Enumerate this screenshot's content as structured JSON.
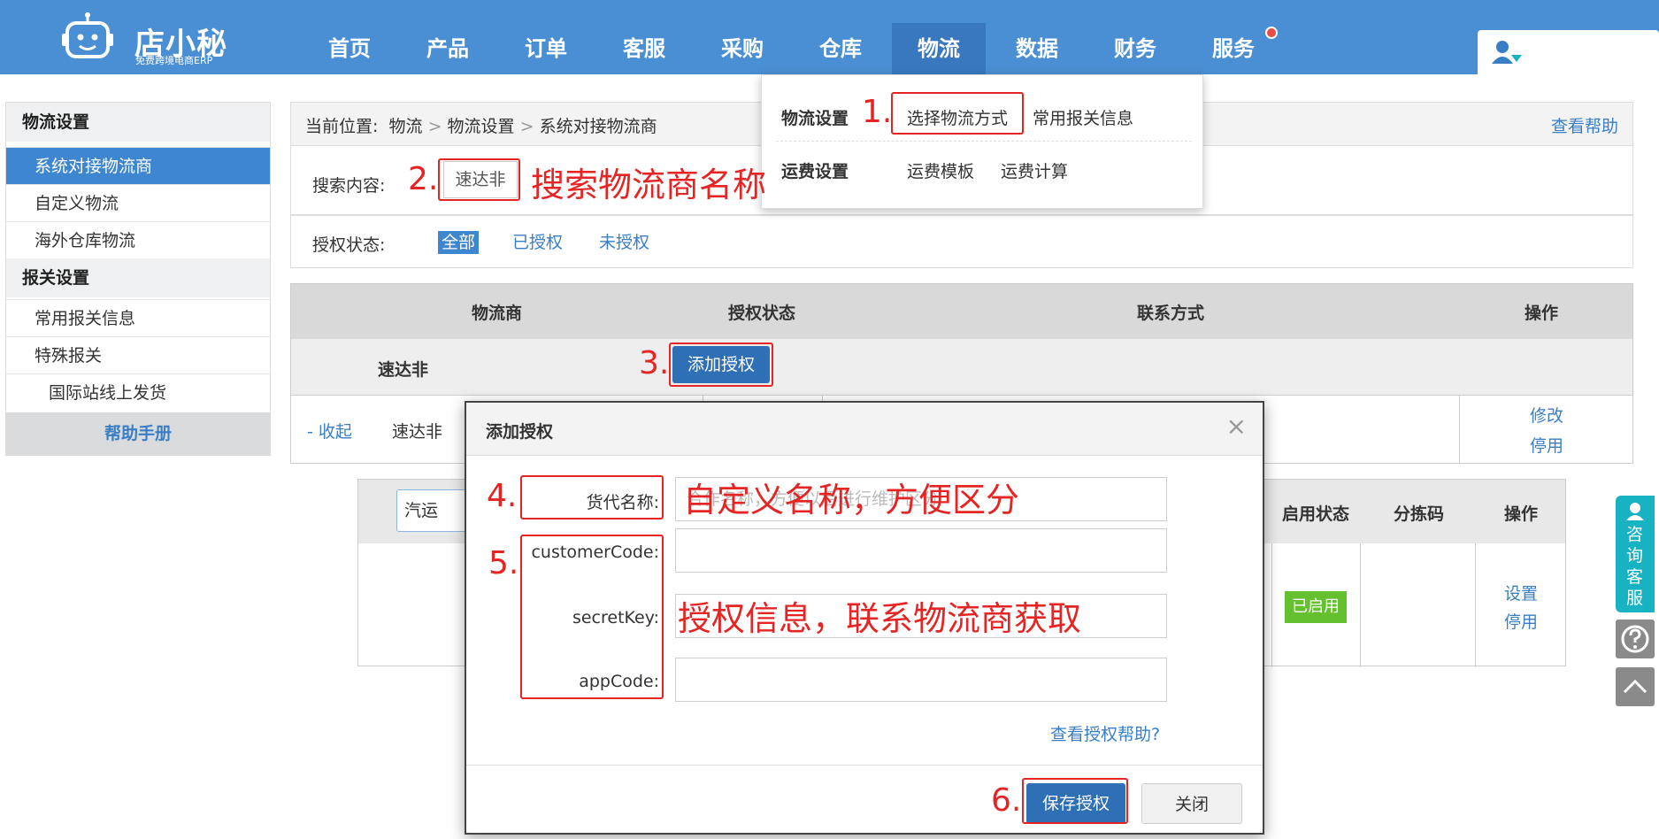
{
  "brand": {
    "name": "店小秘",
    "tagline": "免费跨境电商ERP"
  },
  "nav": {
    "items": [
      "首页",
      "产品",
      "订单",
      "客服",
      "采购",
      "仓库",
      "物流",
      "数据",
      "财务",
      "服务"
    ],
    "active": "物流",
    "accent": "#4a8fd3"
  },
  "sidebar": {
    "sections": [
      {
        "title": "物流设置",
        "items": [
          "系统对接物流商",
          "自定义物流",
          "海外仓库物流"
        ]
      },
      {
        "title": "报关设置",
        "items": [
          "常用报关信息",
          "特殊报关",
          "国际站线上发货"
        ]
      }
    ],
    "active_item": "系统对接物流商",
    "help": "帮助手册"
  },
  "breadcrumb": {
    "label": "当前位置:",
    "items": [
      "物流",
      "物流设置",
      "系统对接物流商"
    ],
    "help_link": "查看帮助"
  },
  "dropdown": {
    "row1": {
      "title": "物流设置",
      "links": [
        "选择物流方式",
        "常用报关信息"
      ]
    },
    "row2": {
      "title": "运费设置",
      "links": [
        "运费模板",
        "运费计算"
      ]
    }
  },
  "search": {
    "label": "搜索内容:",
    "value": "速达非"
  },
  "auth_filter": {
    "label": "授权状态:",
    "options": [
      "全部",
      "已授权",
      "未授权"
    ],
    "active": "全部"
  },
  "table": {
    "headers": [
      "物流商",
      "授权状态",
      "联系方式",
      "操作"
    ],
    "provider_row": {
      "name": "速达非",
      "button": "添加授权"
    },
    "account_row": {
      "collapse": "- 收起",
      "name": "速达非",
      "actions": [
        "修改",
        "停用"
      ]
    }
  },
  "inner_table": {
    "input_value": "汽运",
    "headers": [
      "启用状态",
      "分拣码",
      "操作"
    ],
    "status_badge": "已启用",
    "actions": [
      "设置",
      "停用"
    ]
  },
  "modal": {
    "title": "添加授权",
    "close": "×",
    "fields": [
      {
        "label": "货代名称:",
        "placeholder": "合作名称，方便以后进行维护区分"
      },
      {
        "label": "customerCode:"
      },
      {
        "label": "secretKey:"
      },
      {
        "label": "appCode:"
      }
    ],
    "help_link": "查看授权帮助?",
    "save": "保存授权",
    "cancel": "关闭"
  },
  "annotations": {
    "n1": "1.",
    "n2": "2.",
    "n3": "3.",
    "n4": "4.",
    "n5": "5.",
    "n6": "6.",
    "search_hint": "搜索物流商名称",
    "name_hint": "自定义名称，方便区分",
    "auth_hint": "授权信息，联系物流商获取",
    "color": "#e52424"
  },
  "float_panel": {
    "consult": [
      "咨",
      "询",
      "客",
      "服"
    ]
  }
}
